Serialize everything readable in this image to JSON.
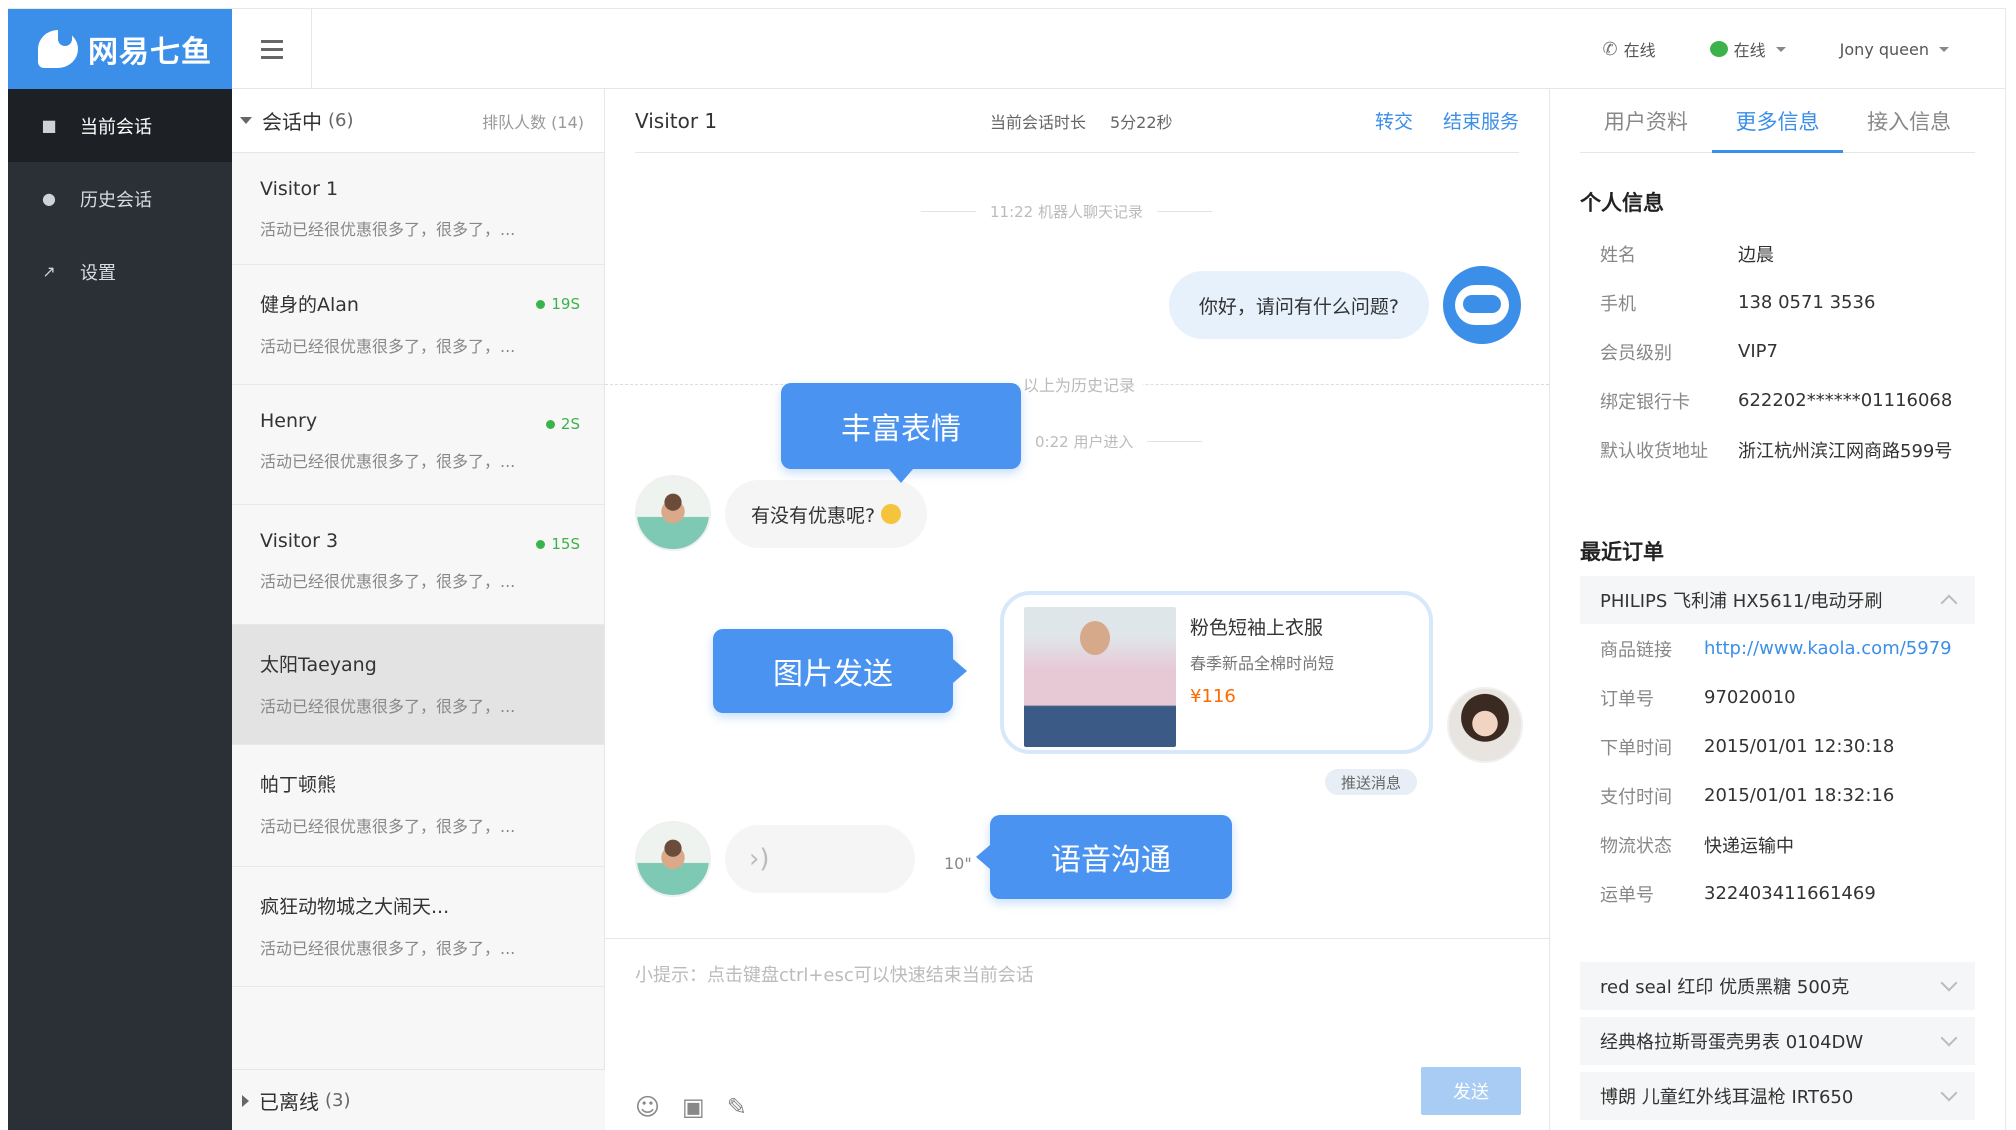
{
  "app": {
    "name": "网易七鱼"
  },
  "sidebar": {
    "items": [
      {
        "label": "当前会话",
        "icon": "chat-icon"
      },
      {
        "label": "历史会话",
        "icon": "clock-icon"
      },
      {
        "label": "设置",
        "icon": "wrench-icon"
      }
    ]
  },
  "topbar": {
    "phone_status": "在线",
    "im_status": "在线",
    "user": "Jony queen"
  },
  "sessions": {
    "active_label": "会话中",
    "active_count": "(6)",
    "queue": "排队人数 (14)",
    "items": [
      {
        "name": "Visitor 1",
        "msg": "活动已经很优惠很多了，很多了，...",
        "time": ""
      },
      {
        "name": "健身的Alan",
        "msg": "活动已经很优惠很多了，很多了，...",
        "time": "19S"
      },
      {
        "name": "Henry",
        "msg": "活动已经很优惠很多了，很多了，...",
        "time": "2S"
      },
      {
        "name": "Visitor 3",
        "msg": "活动已经很优惠很多了，很多了，...",
        "time": "15S"
      },
      {
        "name": "太阳Taeyang",
        "msg": "活动已经很优惠很多了，很多了，...",
        "time": ""
      },
      {
        "name": "帕丁顿熊",
        "msg": "活动已经很优惠很多了，很多了，...",
        "time": ""
      },
      {
        "name": "疯狂动物城之大闹天...",
        "msg": "活动已经很优惠很多了，很多了，...",
        "time": ""
      }
    ],
    "offline_label": "已离线",
    "offline_count": "(3)"
  },
  "chat": {
    "visitor": "Visitor 1",
    "duration_label": "当前会话时长",
    "duration": "5分22秒",
    "transfer": "转交",
    "end": "结束服务",
    "robot_record": "11:22  机器人聊天记录",
    "robot_msg": "你好，请问有什么问题?",
    "history_marker": "以上为历史记录",
    "user_enter": "0:22  用户进入",
    "user_msg": "有没有优惠呢?",
    "product": {
      "title": "粉色短袖上衣服",
      "subtitle": "春季新品全棉时尚短",
      "price": "¥116"
    },
    "push_tag": "推送消息",
    "voice_length": "10\"",
    "callouts": {
      "emoji": "丰富表情",
      "image": "图片发送",
      "voice": "语音沟通"
    },
    "hint": "小提示：点击键盘ctrl+esc可以快速结束当前会话",
    "send": "发送"
  },
  "info": {
    "tabs": [
      "用户资料",
      "更多信息",
      "接入信息"
    ],
    "personal_title": "个人信息",
    "personal": [
      {
        "k": "姓名",
        "v": "边晨"
      },
      {
        "k": "手机",
        "v": "138 0571 3536"
      },
      {
        "k": "会员级别",
        "v": "VIP7"
      },
      {
        "k": "绑定银行卡",
        "v": "622202******01116068"
      },
      {
        "k": "默认收货地址",
        "v": "浙江杭州滨江网商路599号"
      }
    ],
    "orders_title": "最近订单",
    "order_open": {
      "title": "PHILIPS 飞利浦 HX5611/电动牙刷",
      "fields": [
        {
          "k": "商品链接",
          "v": "http://www.kaola.com/5979"
        },
        {
          "k": "订单号",
          "v": "97020010"
        },
        {
          "k": "下单时间",
          "v": "2015/01/01  12:30:18"
        },
        {
          "k": "支付时间",
          "v": "2015/01/01  18:32:16"
        },
        {
          "k": "物流状态",
          "v": "快递运输中"
        },
        {
          "k": "运单号",
          "v": "322403411661469"
        }
      ]
    },
    "orders_collapsed": [
      "red seal 红印 优质黑糖 500克",
      "经典格拉斯哥蛋壳男表 0104DW",
      "博朗 儿童红外线耳温枪 IRT650"
    ]
  }
}
